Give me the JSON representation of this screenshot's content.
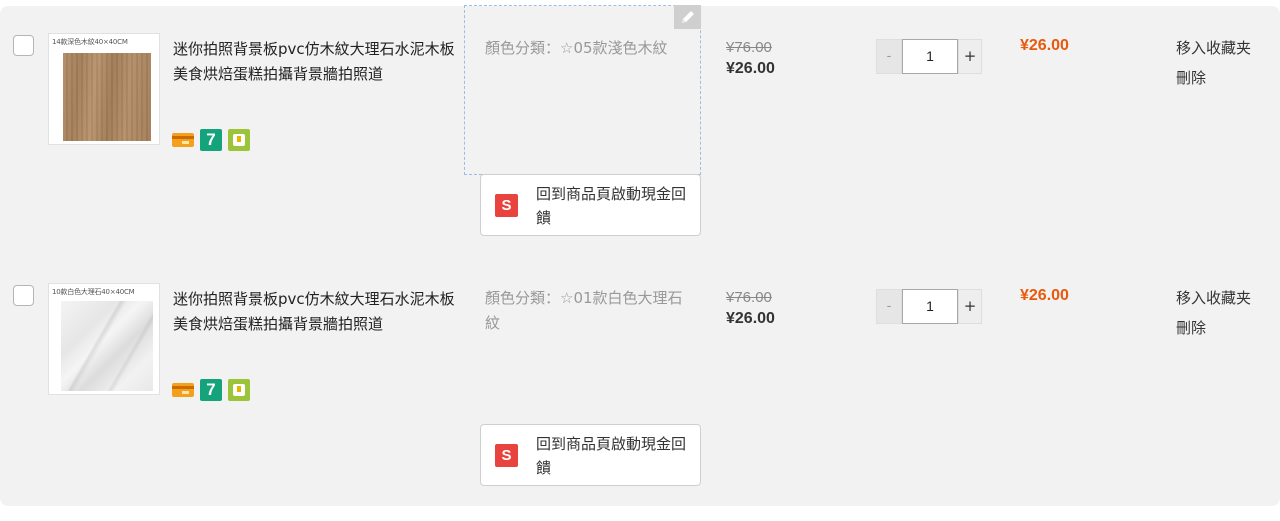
{
  "cart_items": [
    {
      "thumb_caption": "14款深色木紋40×40CM",
      "title": "迷你拍照背景板pvc仿木紋大理石水泥木板美食烘焙蛋糕拍攝背景牆拍照道",
      "badges": [
        "credit-card-icon",
        "seven-eleven-icon",
        "store-pickup-icon"
      ],
      "variant": "顏色分類：☆05款淺色木紋",
      "cashback_icon": "S",
      "cashback_label": "回到商品頁啟動現金回饋",
      "price_original": "¥76.00",
      "price_current": "¥26.00",
      "quantity": "1",
      "qty_minus": "-",
      "qty_plus": "+",
      "subtotal": "¥26.00",
      "move_to_favorites": "移入收藏夹",
      "delete": "刪除"
    },
    {
      "thumb_caption": "10款白色大理石40×40CM",
      "title": "迷你拍照背景板pvc仿木紋大理石水泥木板美食烘焙蛋糕拍攝背景牆拍照道",
      "badges": [
        "credit-card-icon",
        "seven-eleven-icon",
        "store-pickup-icon"
      ],
      "variant": "顏色分類：☆01款白色大理石紋",
      "cashback_icon": "S",
      "cashback_label": "回到商品頁啟動現金回饋",
      "price_original": "¥76.00",
      "price_current": "¥26.00",
      "quantity": "1",
      "qty_minus": "-",
      "qty_plus": "+",
      "subtotal": "¥26.00",
      "move_to_favorites": "移入收藏夹",
      "delete": "刪除"
    }
  ],
  "badge_seven_label": "7",
  "colors": {
    "subtotal": "#e8590c",
    "cashback_icon": "#e8433e",
    "seven_eleven": "#14a37a",
    "edit_border": "#9dbde3"
  }
}
